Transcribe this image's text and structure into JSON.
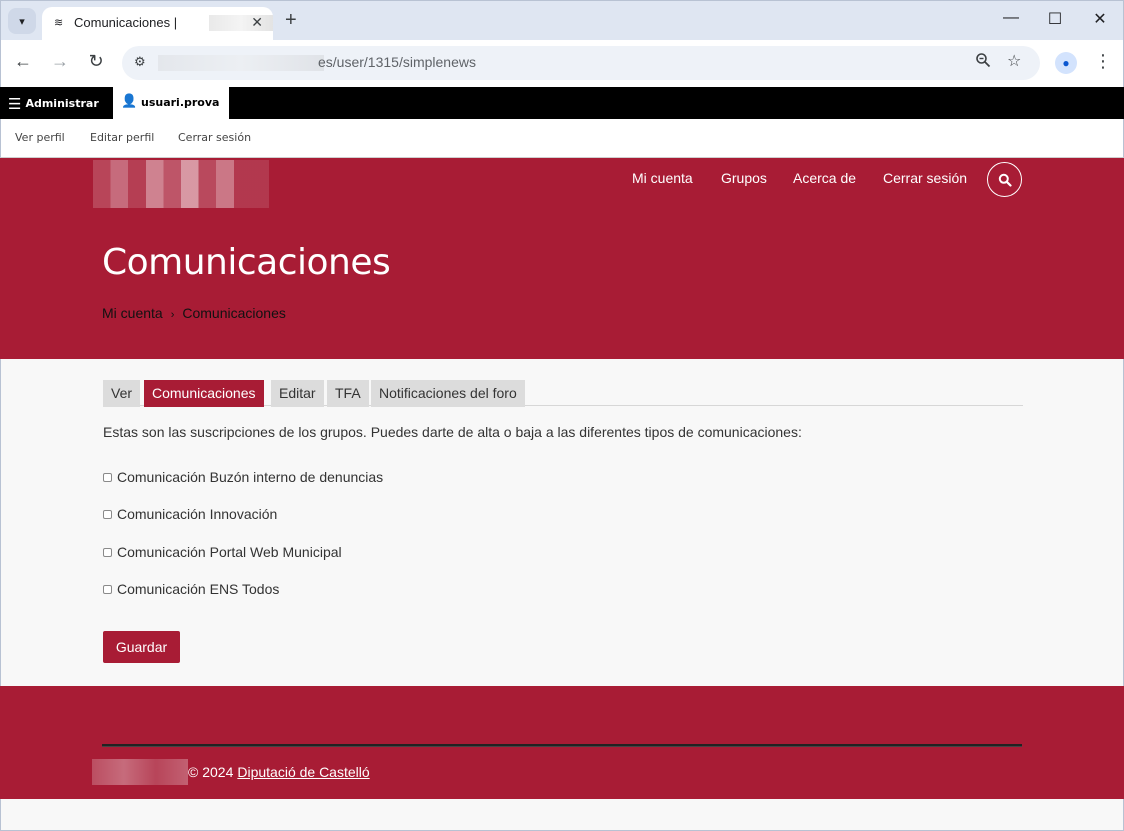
{
  "browser": {
    "tab_list_icon": "chevron-down-icon",
    "tab_title": "Comunicaciones |",
    "tab_close": "✕",
    "new_tab": "+",
    "window_minimize": "—",
    "window_maximize": "☐",
    "window_close": "✕",
    "url": "es/user/1315/simplenews",
    "icons": [
      "back-icon",
      "forward-icon",
      "reload-icon",
      "site-info-icon",
      "zoom-icon",
      "star-icon",
      "profile-icon",
      "more-icon"
    ]
  },
  "admin_toolbar": {
    "manage_label": "Administrar",
    "user_label": "usuari.prova",
    "tray": {
      "view_profile": "Ver perfil",
      "edit_profile": "Editar perfil",
      "logout": "Cerrar sesión"
    }
  },
  "header": {
    "nav": [
      {
        "label": "Mi cuenta"
      },
      {
        "label": "Grupos"
      },
      {
        "label": "Acerca de"
      },
      {
        "label": "Cerrar sesión"
      }
    ],
    "title": "Comunicaciones",
    "breadcrumb": [
      {
        "label": "Mi cuenta"
      },
      {
        "label": "Comunicaciones"
      }
    ],
    "breadcrumb_separator": "›"
  },
  "local_tabs": [
    {
      "label": "Ver",
      "active": false
    },
    {
      "label": "Comunicaciones",
      "active": true
    },
    {
      "label": "Editar",
      "active": false
    },
    {
      "label": "TFA",
      "active": false
    },
    {
      "label": "Notificaciones del foro",
      "active": false
    }
  ],
  "form": {
    "intro": "Estas son las suscripciones de los grupos. Puedes darte de alta o baja a las diferentes tipos de comunicaciones:",
    "options": [
      {
        "label": "Comunicación Buzón interno de denuncias",
        "checked": false
      },
      {
        "label": "Comunicación Innovación",
        "checked": false
      },
      {
        "label": "Comunicación Portal Web Municipal",
        "checked": false
      },
      {
        "label": "Comunicación ENS Todos",
        "checked": false
      }
    ],
    "submit_label": "Guardar"
  },
  "footer": {
    "copyright": "© 2024",
    "link": "Diputació de Castelló"
  },
  "colors": {
    "brand": "#a81c35",
    "admin_bar": "#000000",
    "tab_inactive": "#dcdcdc"
  }
}
